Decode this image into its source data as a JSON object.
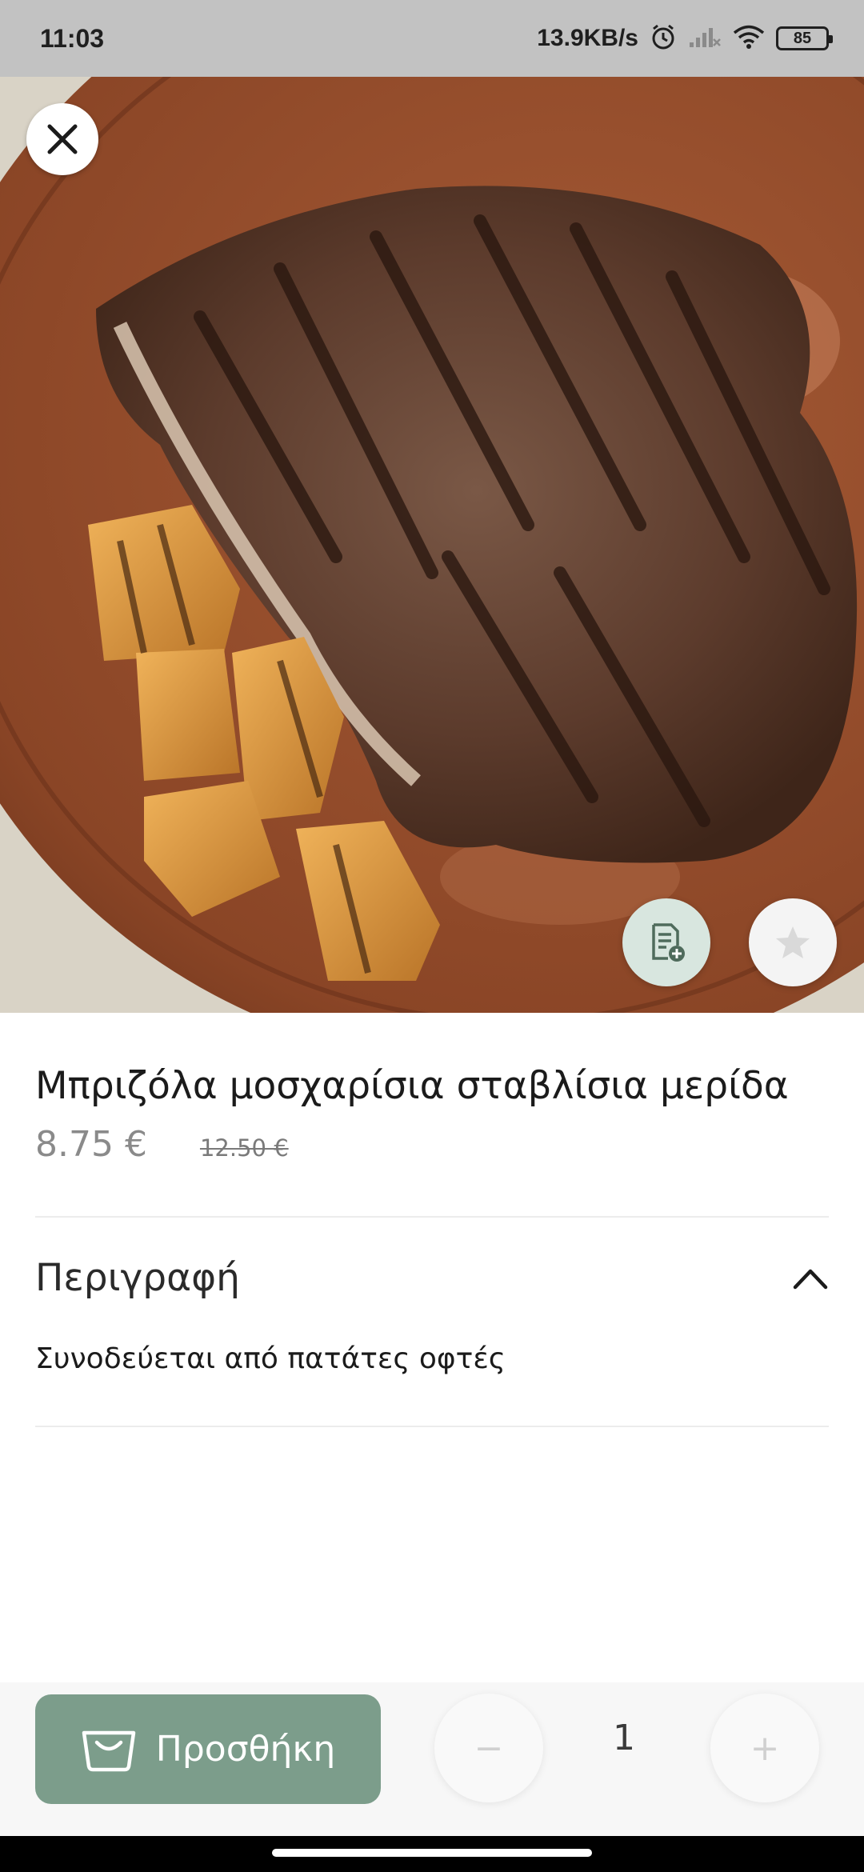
{
  "status_bar": {
    "time": "11:03",
    "network_speed": "13.9KB/s",
    "battery_level": "85",
    "icons": [
      "alarm-icon",
      "signal-icon",
      "wifi-icon",
      "battery-icon"
    ]
  },
  "hero": {
    "image_subject": "grilled beef steak with roasted potatoes on wooden board",
    "close_icon": "close-icon",
    "note_icon": "add-note-icon",
    "favorite_icon": "star-icon"
  },
  "product": {
    "title": "Μπριζόλα μοσχαρίσια σταβλίσια μερίδα",
    "price": "8.75 €",
    "old_price": "12.50 €"
  },
  "description": {
    "heading": "Περιγραφή",
    "text": "Συνοδεύεται από πατάτες οφτές",
    "toggle_icon": "chevron-up-icon"
  },
  "cart": {
    "add_label": "Προσθήκη",
    "add_icon": "basket-icon",
    "quantity": "1",
    "minus_label": "−",
    "plus_label": "+"
  },
  "colors": {
    "accent": "#7c9d8b",
    "status_bar": "#c2c2c2",
    "note_button": "#d8e6df"
  }
}
